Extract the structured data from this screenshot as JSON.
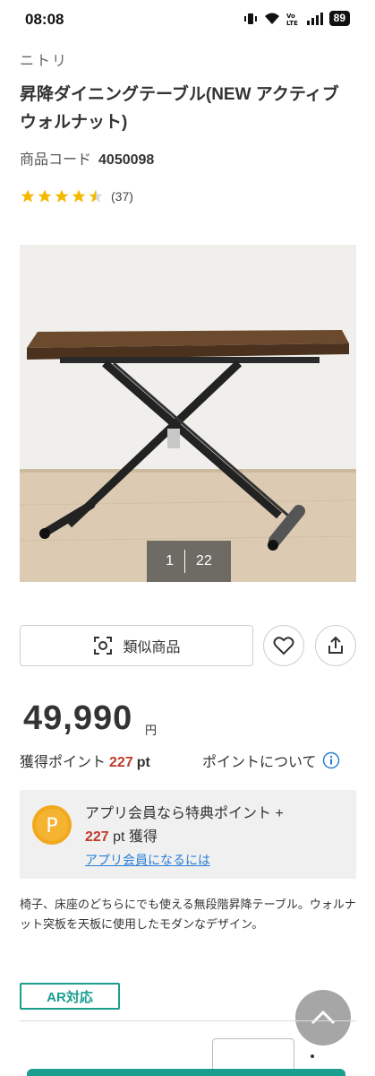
{
  "status_bar": {
    "time": "08:08",
    "battery": "89",
    "icons": [
      "vibrate-icon",
      "wifi-icon",
      "volte-icon",
      "signal-icon",
      "battery-icon"
    ]
  },
  "product": {
    "brand": "ニトリ",
    "title": "昇降ダイニングテーブル(NEW アクティブ ウォルナット)",
    "code_label": "商品コード",
    "code_value": "4050098",
    "rating": 4.5,
    "review_count": "(37)"
  },
  "gallery": {
    "current": "1",
    "total": "22",
    "image_alt": "table-photo"
  },
  "actions": {
    "similar_label": "類似商品",
    "favorite_icon": "heart-icon",
    "share_icon": "share-icon"
  },
  "price": {
    "value": "49,990",
    "unit": "円"
  },
  "points": {
    "label": "獲得ポイント",
    "value": "227",
    "unit": "pt",
    "about_label": "ポイントについて"
  },
  "app_promo": {
    "icon_letter": "P",
    "line1": "アプリ会員なら特典ポイント +",
    "points": "227",
    "line2_suffix": "pt 獲得",
    "link": "アプリ会員になるには"
  },
  "description": "椅子、床座のどちらにでも使える無段階昇降テーブル。ウォルナット突板を天板に使用したモダンなデザイン。",
  "ar_badge": "AR対応",
  "colors": {
    "accent": "#1a9e8e",
    "price_points": "#c0392b",
    "link": "#2a7fd4",
    "star": "#f5b800"
  }
}
